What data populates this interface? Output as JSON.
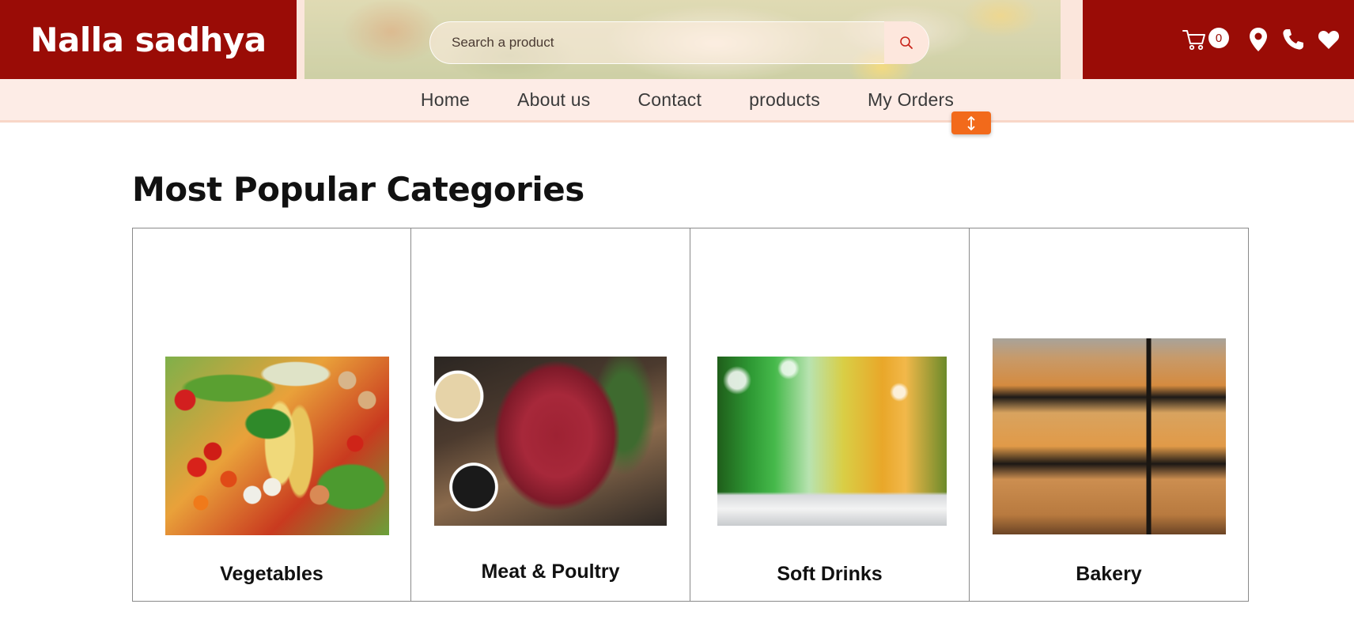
{
  "brand": {
    "name": "Nalla sadhya",
    "color": "#9a0c06"
  },
  "search": {
    "placeholder": "Search a product",
    "icon": "search-icon"
  },
  "header_actions": {
    "cart_count": "0",
    "icons": [
      "cart-icon",
      "location-pin-icon",
      "phone-icon",
      "heart-icon"
    ]
  },
  "nav": {
    "items": [
      {
        "label": "Home"
      },
      {
        "label": "About us"
      },
      {
        "label": "Contact"
      },
      {
        "label": "products"
      },
      {
        "label": "My Orders"
      }
    ]
  },
  "scroll_handle": {
    "icon": "vertical-arrows-icon",
    "color": "#f26a1b"
  },
  "main": {
    "title": "Most Popular Categories",
    "categories": [
      {
        "label": "Vegetables",
        "image": "vegetables-image"
      },
      {
        "label": "Meat & Poultry",
        "image": "meat-image"
      },
      {
        "label": "Soft Drinks",
        "image": "soft-drinks-image"
      },
      {
        "label": "Bakery",
        "image": "bakery-image"
      }
    ]
  }
}
